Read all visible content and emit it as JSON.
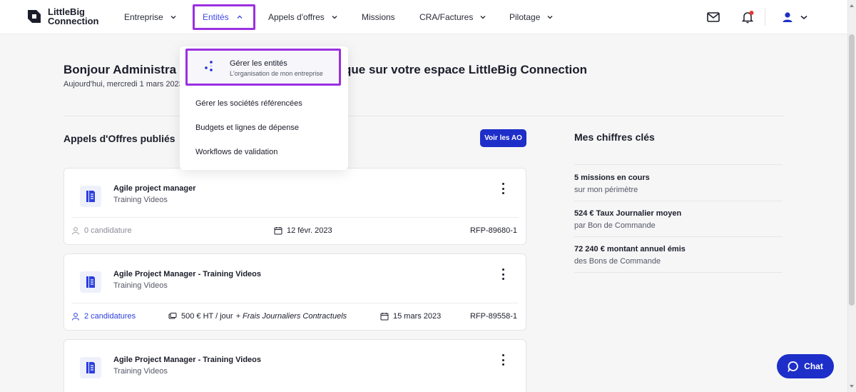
{
  "app": {
    "logo_line1": "LittleBig",
    "logo_line2": "Connection"
  },
  "nav": {
    "entreprise": "Entreprise",
    "entites": "Entités",
    "appels": "Appels d'offres",
    "missions": "Missions",
    "cra": "CRA/Factures",
    "pilotage": "Pilotage"
  },
  "header": {
    "greeting_start": "Bonjour Administra",
    "greeting_end": "que sur votre espace LittleBig Connection",
    "date": "Aujourd'hui, mercredi 1 mars 2023"
  },
  "dropdown": {
    "highlight_title": "Gérer les entités",
    "highlight_sub": "L'organisation de mon entreprise",
    "item1": "Gérer les sociétés référencées",
    "item2": "Budgets et lignes de dépense",
    "item3": "Workflows de validation"
  },
  "ao_section": {
    "title": "Appels d'Offres publiés",
    "button": "Voir les AO"
  },
  "cards": [
    {
      "title": "Agile project manager",
      "subtitle": "Training Videos",
      "candidates": "0 candidature",
      "date": "12 févr. 2023",
      "ref": "RFP-89680-1"
    },
    {
      "title": "Agile Project Manager - Training Videos",
      "subtitle": "Training Videos",
      "candidates": "2 candidatures",
      "rate": "500 € HT / jour",
      "rate_extra": "+ Frais Journaliers Contractuels",
      "date": "15 mars 2023",
      "ref": "RFP-89558-1"
    },
    {
      "title": "Agile Project Manager - Training Videos",
      "subtitle": "Training Videos"
    }
  ],
  "kpis": {
    "title": "Mes chiffres clés",
    "items": [
      {
        "value": "5 missions en cours",
        "label": "sur mon périmètre"
      },
      {
        "value": "524 € Taux Journalier moyen",
        "label": "par Bon de Commande"
      },
      {
        "value": "72 240 € montant annuel émis",
        "label": "des Bons de Commande"
      }
    ]
  },
  "chat": {
    "label": "Chat"
  },
  "colors": {
    "brand_blue": "#1d2ec9",
    "highlight_purple": "#9b30e0",
    "notification_red": "#e53935"
  }
}
